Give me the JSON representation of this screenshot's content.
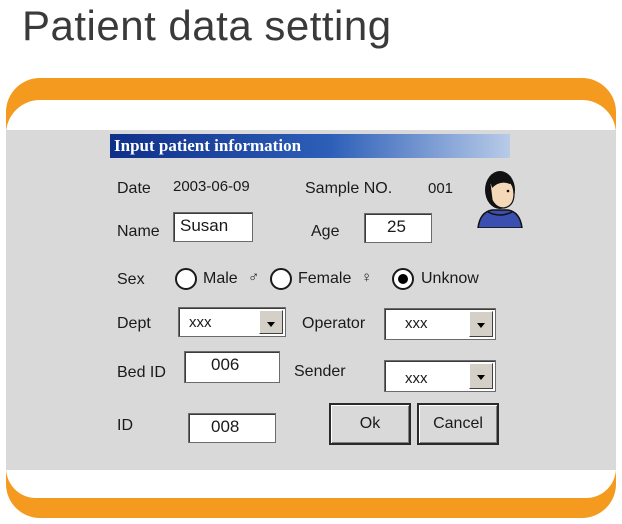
{
  "page_title": "Patient data setting",
  "dialog": {
    "title": "Input patient information",
    "date_label": "Date",
    "date_value": "2003-06-09",
    "sample_label": "Sample NO.",
    "sample_value": "001",
    "name_label": "Name",
    "name_value": "Susan",
    "age_label": "Age",
    "age_value": "25",
    "sex_label": "Sex",
    "sex_options": [
      {
        "label": "Male",
        "symbol": "♂",
        "checked": false
      },
      {
        "label": "Female",
        "symbol": "♀",
        "checked": false
      },
      {
        "label": "Unknow",
        "symbol": "",
        "checked": true
      }
    ],
    "dept_label": "Dept",
    "dept_value": "xxx",
    "operator_label": "Operator",
    "operator_value": "xxx",
    "bed_label": "Bed ID",
    "bed_value": "006",
    "sender_label": "Sender",
    "sender_value": "xxx",
    "id_label": "ID",
    "id_value": "008",
    "ok_label": "Ok",
    "cancel_label": "Cancel"
  },
  "colors": {
    "frame_orange": "#f39a1f",
    "panel_gray": "#d9d9d9",
    "title_blue": "#0f2f8a"
  },
  "icons": {
    "avatar": "patient-avatar-icon",
    "dropdown": "chevron-down-icon"
  }
}
